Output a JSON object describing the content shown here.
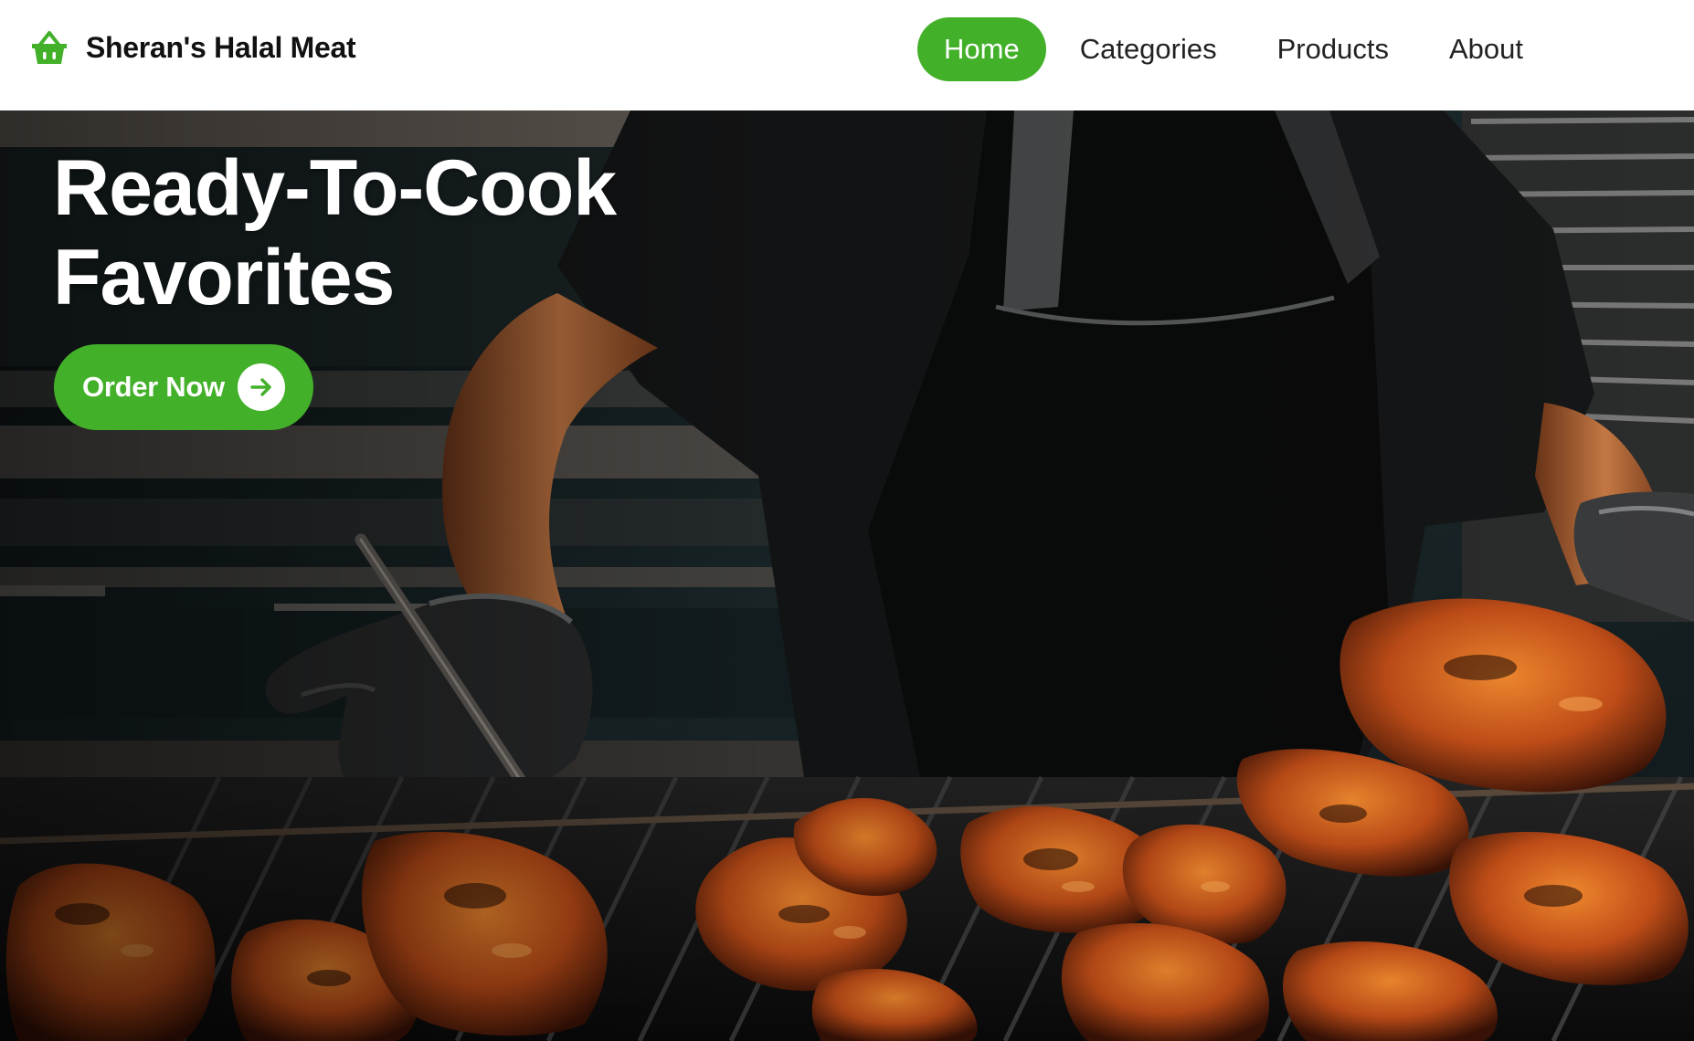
{
  "brand": {
    "name": "Sheran's Halal Meat",
    "icon": "shopping-basket-icon"
  },
  "nav": {
    "items": [
      {
        "label": "Home",
        "active": true
      },
      {
        "label": "Categories",
        "active": false
      },
      {
        "label": "Products",
        "active": false
      },
      {
        "label": "About",
        "active": false
      }
    ]
  },
  "hero": {
    "title_line1": "Ready-To-Cook",
    "title_line2": "Favorites",
    "cta_label": "Order Now",
    "cta_icon": "arrow-right-icon"
  },
  "colors": {
    "accent": "#43b02a",
    "text_dark": "#111111",
    "text_light": "#ffffff"
  }
}
